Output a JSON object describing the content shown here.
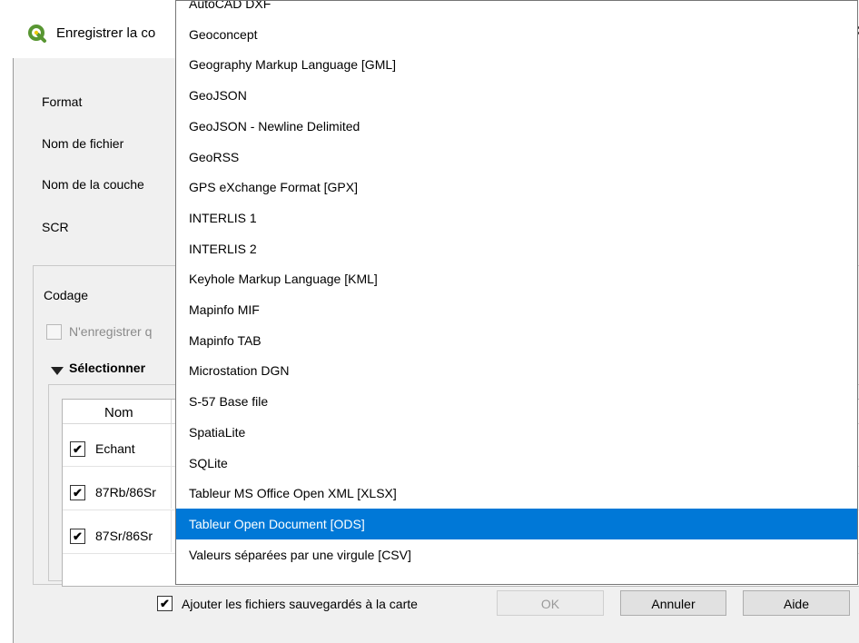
{
  "window": {
    "title": "Enregistrer la couche vectorielle sous...",
    "title_visible": "Enregistrer la co",
    "icon": "qgis-logo-icon",
    "close_glyph": "✕"
  },
  "form": {
    "format_label": "Format",
    "filename_label": "Nom de fichier",
    "layername_label": "Nom de la couche",
    "crs_label": "SCR"
  },
  "encoding": {
    "codage_label": "Codage",
    "selected_only_label": "N'enregistrer q"
  },
  "fields_section": {
    "title": "Sélectionner",
    "column_header": "Nom",
    "rows": [
      {
        "label": "Echant",
        "checked": true
      },
      {
        "label": "87Rb/86Sr",
        "checked": true
      },
      {
        "label": "87Sr/86Sr",
        "checked": true
      }
    ]
  },
  "footer": {
    "add_to_map_label": "Ajouter les fichiers sauvegardés à la carte",
    "add_to_map_checked": true,
    "ok_label": "OK",
    "cancel_label": "Annuler",
    "help_label": "Aide"
  },
  "format_dropdown": {
    "selected": "Tableur Open Document  [ODS]",
    "items": [
      "AutoCAD DXF",
      "Geoconcept",
      "Geography Markup Language [GML]",
      "GeoJSON",
      "GeoJSON - Newline Delimited",
      "GeoRSS",
      "GPS eXchange Format [GPX]",
      "INTERLIS 1",
      "INTERLIS 2",
      "Keyhole Markup Language [KML]",
      "Mapinfo MIF",
      "Mapinfo TAB",
      "Microstation DGN",
      "S-57 Base file",
      "SpatiaLite",
      "SQLite",
      "Tableur MS Office Open XML [XLSX]",
      "Tableur Open Document  [ODS]",
      "Valeurs séparées par une virgule [CSV]"
    ]
  },
  "colors": {
    "selection": "#0078d7",
    "dialog_bg": "#f0f0f0",
    "qgis_green": "#589632",
    "qgis_yellow": "#eec90d"
  }
}
